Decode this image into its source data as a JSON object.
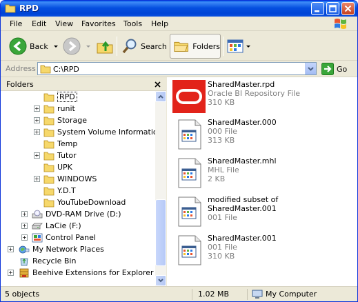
{
  "window": {
    "title": "RPD"
  },
  "menu": {
    "items": [
      "File",
      "Edit",
      "View",
      "Favorites",
      "Tools",
      "Help"
    ]
  },
  "toolbar": {
    "back_label": "Back",
    "search_label": "Search",
    "folders_label": "Folders"
  },
  "address": {
    "label": "Address",
    "value": "C:\\RPD",
    "go_label": "Go"
  },
  "folders_pane": {
    "title": "Folders",
    "items": [
      {
        "label": "RPD",
        "icon": "folder-icon",
        "selected": true,
        "expander": false
      },
      {
        "label": "runit",
        "icon": "folder-icon",
        "expander": true
      },
      {
        "label": "Storage",
        "icon": "folder-icon",
        "expander": true
      },
      {
        "label": "System Volume Information",
        "icon": "folder-icon",
        "expander": true
      },
      {
        "label": "Temp",
        "icon": "folder-icon",
        "expander": false
      },
      {
        "label": "Tutor",
        "icon": "folder-icon",
        "expander": true
      },
      {
        "label": "UPK",
        "icon": "folder-icon",
        "expander": false
      },
      {
        "label": "WINDOWS",
        "icon": "folder-icon",
        "expander": true
      },
      {
        "label": "Y.D.T",
        "icon": "folder-icon",
        "expander": false
      },
      {
        "label": "YouTubeDownload",
        "icon": "folder-icon",
        "expander": false
      },
      {
        "label": "DVD-RAM Drive (D:)",
        "icon": "dvd-drive-icon",
        "expander": true
      },
      {
        "label": "LaCie (F:)",
        "icon": "hard-drive-icon",
        "expander": true
      },
      {
        "label": "Control Panel",
        "icon": "control-panel-icon",
        "expander": true
      },
      {
        "label": "My Network Places",
        "icon": "network-places-icon",
        "expander": true
      },
      {
        "label": "Recycle Bin",
        "icon": "recycle-bin-icon",
        "expander": false
      },
      {
        "label": "Beehive Extensions for Explorer",
        "icon": "beehive-icon",
        "expander": true
      }
    ]
  },
  "files": [
    {
      "name": "SharedMaster.rpd",
      "type": "Oracle BI Repository File",
      "size": "310 KB",
      "icon": "oracle-logo-icon"
    },
    {
      "name": "SharedMaster.000",
      "type": "000 File",
      "size": "313 KB",
      "icon": "generic-file-icon"
    },
    {
      "name": "SharedMaster.mhl",
      "type": "MHL File",
      "size": "2 KB",
      "icon": "generic-file-icon"
    },
    {
      "name": "modified subset of SharedMaster.001",
      "type": "001 File",
      "size": "",
      "icon": "generic-file-icon"
    },
    {
      "name": "SharedMaster.001",
      "type": "001 File",
      "size": "310 KB",
      "icon": "generic-file-icon"
    }
  ],
  "status": {
    "objects": "5 objects",
    "size": "1.02 MB",
    "location": "My Computer"
  },
  "colors": {
    "titlebar": "#0550e0",
    "oracle_red": "#e2231a",
    "window_bg": "#ece9d8"
  }
}
